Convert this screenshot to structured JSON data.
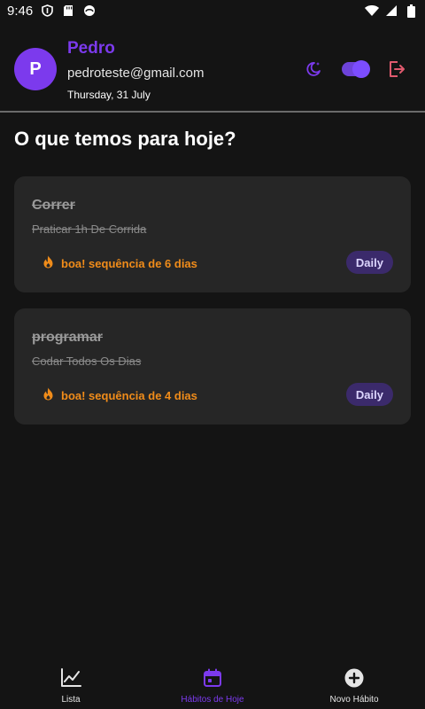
{
  "status_bar": {
    "time": "9:46"
  },
  "header": {
    "avatar_initial": "P",
    "name": "Pedro",
    "email": "pedroteste@gmail.com",
    "date": "Thursday, 31 July"
  },
  "page_title": "O que temos para hoje?",
  "habits": [
    {
      "title": "Correr",
      "description": "Praticar 1h De Corrida",
      "streak": "boa! sequência de 6 dias",
      "frequency": "Daily",
      "completed": true
    },
    {
      "title": "programar",
      "description": "Codar Todos Os Dias",
      "streak": "boa! sequência de 4 dias",
      "frequency": "Daily",
      "completed": true
    }
  ],
  "bottom_nav": {
    "items": [
      {
        "label": "Lista",
        "icon": "chart-line-icon"
      },
      {
        "label": "Hábitos de Hoje",
        "icon": "calendar-icon",
        "active": true
      },
      {
        "label": "Novo Hábito",
        "icon": "plus-circle-icon"
      }
    ]
  },
  "colors": {
    "accent": "#7c3aed",
    "streak": "#f08c1a",
    "logout": "#e05a6e",
    "card": "#262626",
    "background": "#141414"
  }
}
